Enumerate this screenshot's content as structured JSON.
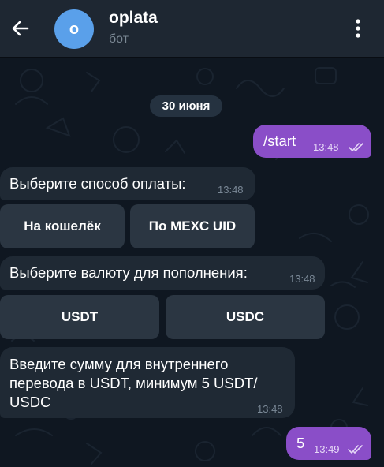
{
  "header": {
    "avatar_letter": "o",
    "title": "oplata",
    "subtitle": "бот",
    "back_icon": "arrow-left-icon",
    "menu_icon": "kebab-menu-icon"
  },
  "colors": {
    "header_bg": "#1e2732",
    "chat_bg": "#0f1721",
    "outgoing_bubble": "#8a4ec8",
    "incoming_bubble": "#1f2934",
    "keyboard_button": "#2b3642",
    "avatar": "#5aa0ea"
  },
  "chat": {
    "date_label": "30 июня",
    "messages": [
      {
        "direction": "out",
        "text": "/start",
        "time": "13:48",
        "status": "read"
      },
      {
        "direction": "in",
        "text": "Выберите способ оплаты:",
        "time": "13:48"
      },
      {
        "direction": "in",
        "text": "Выберите валюту для пополнения:",
        "time": "13:48"
      },
      {
        "direction": "in",
        "text_lines": [
          "Введите сумму для внутреннего",
          "перевода в USDT, минимум 5 USDT/",
          "USDC"
        ],
        "time": "13:48"
      },
      {
        "direction": "out",
        "text": "5",
        "time": "13:49",
        "status": "read"
      }
    ],
    "keyboards": [
      {
        "buttons": [
          "На кошелёк",
          "По MEXC UID"
        ]
      },
      {
        "buttons": [
          "USDT",
          "USDC"
        ]
      }
    ]
  }
}
